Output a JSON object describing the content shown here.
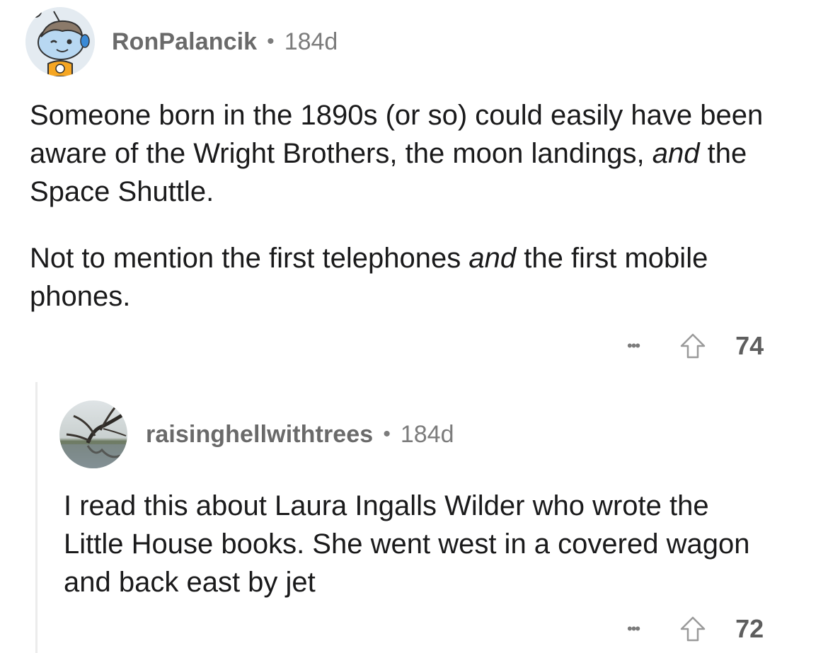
{
  "comment1": {
    "username": "RonPalancik",
    "separator": "•",
    "age": "184d",
    "paragraph1_part1": "Someone born in the 1890s (or so) could easily have been aware of the Wright Brothers, the moon landings, ",
    "paragraph1_emph": "and",
    "paragraph1_part2": " the Space Shuttle.",
    "paragraph2_part1": "Not to mention the first telephones ",
    "paragraph2_emph": "and",
    "paragraph2_part2": " the first mobile phones.",
    "more_label": "•••",
    "upvote_icon": "upvote-arrow-icon",
    "score": "74"
  },
  "comment2": {
    "username": "raisinghellwithtrees",
    "separator": "•",
    "age": "184d",
    "paragraph1": "I read this about Laura Ingalls Wilder who wrote the Little House books. She went west in a covered wagon and back east by jet",
    "more_label": "•••",
    "upvote_icon": "upvote-arrow-icon",
    "score": "72"
  },
  "colors": {
    "text": "#1a1a1b",
    "meta": "#7c7c7c",
    "thread_line": "#ececec",
    "avatar1_bg": "#e4ecf2"
  }
}
